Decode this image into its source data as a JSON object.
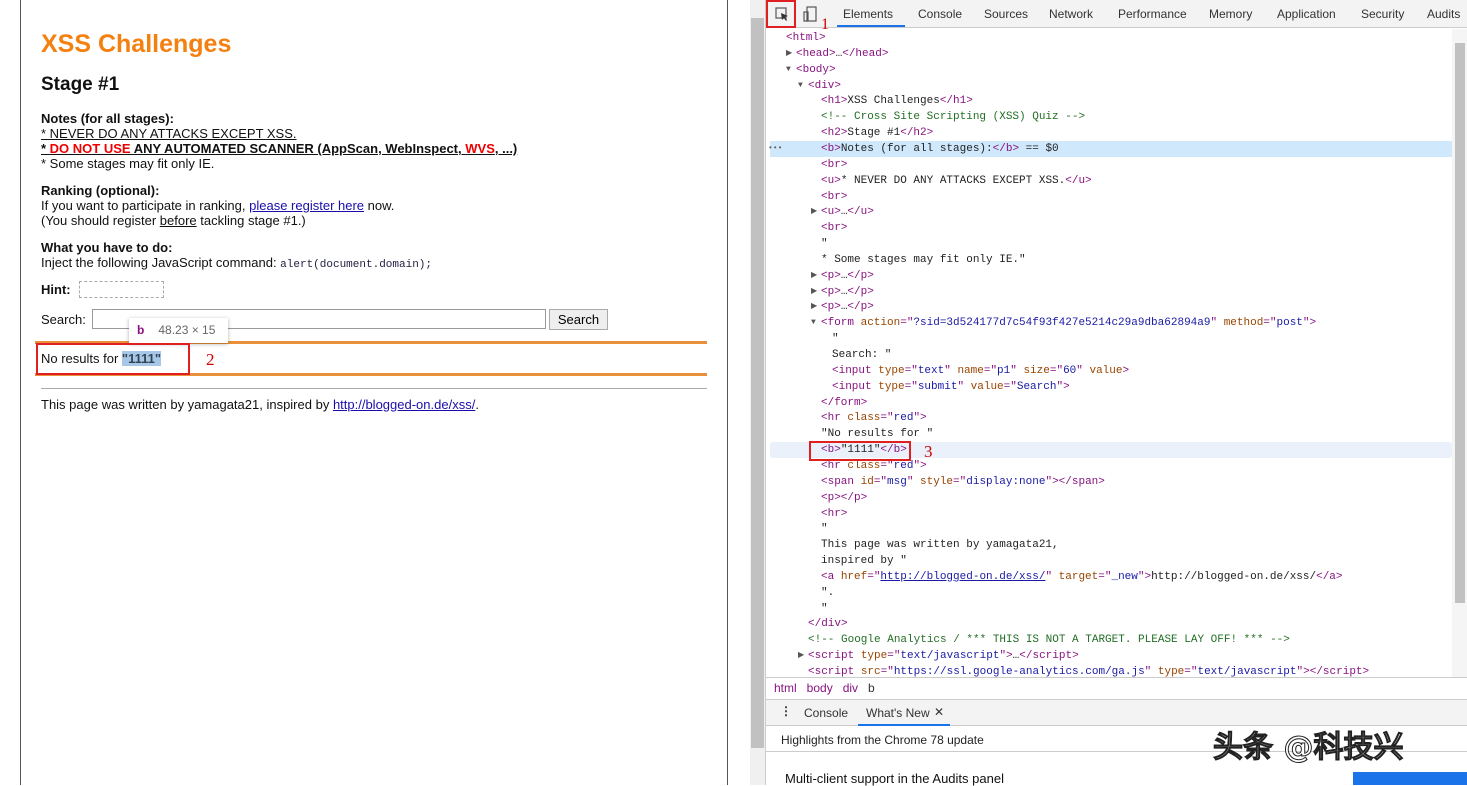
{
  "page": {
    "title": "XSS Challenges",
    "stage": "Stage #1",
    "notes_heading": "Notes (for all stages):",
    "note1": "* NEVER DO ANY ATTACKS EXCEPT XSS.",
    "note2_star": "* ",
    "note2_red": "DO NOT USE",
    "note2_mid": " ANY AUTOMATED SCANNER (AppScan, WebInspect, ",
    "note2_wvs": "WVS",
    "note2_end": ", ...)",
    "note3": "* Some stages may fit only IE.",
    "ranking_heading": "Ranking (optional):",
    "ranking_pre": "If you want to participate in ranking, ",
    "ranking_link": "please register here",
    "ranking_post": " now.",
    "register_pre": "(You should register ",
    "register_u": "before",
    "register_post": " tackling stage #1.)",
    "todo_heading": "What you have to do:",
    "todo_text": "Inject the following JavaScript command: ",
    "todo_code": "alert(document.domain);",
    "hint_label": "Hint:",
    "search_label": "Search:",
    "search_value": "",
    "search_button": "Search",
    "result_pre": "No results for ",
    "result_value": "\"1111\"",
    "footer_pre": "This page was written by yamagata21, inspired by ",
    "footer_link": "http://blogged-on.de/xss/",
    "footer_post": ".",
    "tooltip_tag": "b",
    "tooltip_dims": "48.23 × 15",
    "annotations": [
      "1",
      "2",
      "3"
    ]
  },
  "devtools": {
    "tabs": [
      "Elements",
      "Console",
      "Sources",
      "Network",
      "Performance",
      "Memory",
      "Application",
      "Security",
      "Audits"
    ],
    "active_tab": "Elements",
    "breadcrumbs": [
      "html",
      "body",
      "div",
      "b"
    ],
    "drawer_tabs": [
      "Console",
      "What's New"
    ],
    "highlights": "Highlights from the Chrome 78 update",
    "feature": "Multi-client support in the Audits panel",
    "watermark": "头条 @科技兴",
    "colors": {
      "tag": "#881280",
      "attr_name": "#994500",
      "attr_value": "#1a1aa6",
      "comment": "#236e25",
      "selection": "#cfe8fc"
    },
    "dom_lines": [
      {
        "x": 16,
        "t": [
          [
            "tg",
            "<html>"
          ]
        ]
      },
      {
        "x": 26,
        "a": "▶",
        "t": [
          [
            "tg",
            "<head>"
          ],
          [
            "tx",
            "…"
          ],
          [
            "tg",
            "</head>"
          ]
        ]
      },
      {
        "x": 26,
        "a": "▼",
        "t": [
          [
            "tg",
            "<body>"
          ]
        ]
      },
      {
        "x": 38,
        "a": "▼",
        "t": [
          [
            "tg",
            "<div>"
          ]
        ]
      },
      {
        "x": 51,
        "t": [
          [
            "tg",
            "<h1>"
          ],
          [
            "tx",
            "XSS Challenges"
          ],
          [
            "tg",
            "</h1>"
          ]
        ]
      },
      {
        "x": 51,
        "t": [
          [
            "cm",
            "<!-- Cross Site Scripting (XSS) Quiz -->"
          ]
        ]
      },
      {
        "x": 51,
        "t": [
          [
            "tg",
            "<h2>"
          ],
          [
            "tx",
            "Stage #1"
          ],
          [
            "tg",
            "</h2>"
          ]
        ]
      },
      {
        "x": 51,
        "sel": true,
        "t": [
          [
            "tg",
            "<b>"
          ],
          [
            "tx",
            "Notes (for all stages):"
          ],
          [
            "tg",
            "</b>"
          ],
          [
            "tx",
            " == $0"
          ]
        ]
      },
      {
        "x": 51,
        "t": [
          [
            "tg",
            "<br>"
          ]
        ]
      },
      {
        "x": 51,
        "t": [
          [
            "tg",
            "<u>"
          ],
          [
            "tx",
            "* NEVER DO ANY ATTACKS EXCEPT XSS."
          ],
          [
            "tg",
            "</u>"
          ]
        ]
      },
      {
        "x": 51,
        "t": [
          [
            "tg",
            "<br>"
          ]
        ]
      },
      {
        "x": 51,
        "a": "▶",
        "t": [
          [
            "tg",
            "<u>"
          ],
          [
            "tx",
            "…"
          ],
          [
            "tg",
            "</u>"
          ]
        ]
      },
      {
        "x": 51,
        "t": [
          [
            "tg",
            "<br>"
          ]
        ]
      },
      {
        "x": 51,
        "t": [
          [
            "tx",
            "\""
          ]
        ]
      },
      {
        "x": 51,
        "t": [
          [
            "tx",
            "* Some stages may fit only IE.\""
          ]
        ]
      },
      {
        "x": 51,
        "a": "▶",
        "t": [
          [
            "tg",
            "<p>"
          ],
          [
            "tx",
            "…"
          ],
          [
            "tg",
            "</p>"
          ]
        ]
      },
      {
        "x": 51,
        "a": "▶",
        "t": [
          [
            "tg",
            "<p>"
          ],
          [
            "tx",
            "…"
          ],
          [
            "tg",
            "</p>"
          ]
        ]
      },
      {
        "x": 51,
        "a": "▶",
        "t": [
          [
            "tg",
            "<p>"
          ],
          [
            "tx",
            "…"
          ],
          [
            "tg",
            "</p>"
          ]
        ]
      },
      {
        "x": 51,
        "a": "▼",
        "t": [
          [
            "tg",
            "<form "
          ],
          [
            "an",
            "action"
          ],
          [
            "tg",
            "=\""
          ],
          [
            "av",
            "?sid=3d524177d7c54f93f427e5214c29a9dba62894a9"
          ],
          [
            "tg",
            "\" "
          ],
          [
            "an",
            "method"
          ],
          [
            "tg",
            "=\""
          ],
          [
            "av",
            "post"
          ],
          [
            "tg",
            "\">"
          ]
        ]
      },
      {
        "x": 62,
        "t": [
          [
            "tx",
            "\""
          ]
        ]
      },
      {
        "x": 62,
        "t": [
          [
            "tx",
            "Search: \""
          ]
        ]
      },
      {
        "x": 62,
        "t": [
          [
            "tg",
            "<input "
          ],
          [
            "an",
            "type"
          ],
          [
            "tg",
            "=\""
          ],
          [
            "av",
            "text"
          ],
          [
            "tg",
            "\" "
          ],
          [
            "an",
            "name"
          ],
          [
            "tg",
            "=\""
          ],
          [
            "av",
            "p1"
          ],
          [
            "tg",
            "\" "
          ],
          [
            "an",
            "size"
          ],
          [
            "tg",
            "=\""
          ],
          [
            "av",
            "60"
          ],
          [
            "tg",
            "\" "
          ],
          [
            "an",
            "value"
          ],
          [
            "tg",
            ">"
          ]
        ]
      },
      {
        "x": 62,
        "t": [
          [
            "tg",
            "<input "
          ],
          [
            "an",
            "type"
          ],
          [
            "tg",
            "=\""
          ],
          [
            "av",
            "submit"
          ],
          [
            "tg",
            "\" "
          ],
          [
            "an",
            "value"
          ],
          [
            "tg",
            "=\""
          ],
          [
            "av",
            "Search"
          ],
          [
            "tg",
            "\">"
          ]
        ]
      },
      {
        "x": 51,
        "t": [
          [
            "tg",
            "</form>"
          ]
        ]
      },
      {
        "x": 51,
        "t": [
          [
            "tg",
            "<hr "
          ],
          [
            "an",
            "class"
          ],
          [
            "tg",
            "=\""
          ],
          [
            "av",
            "red"
          ],
          [
            "tg",
            "\">"
          ]
        ]
      },
      {
        "x": 51,
        "t": [
          [
            "tx",
            "\"No results for \""
          ]
        ]
      },
      {
        "x": 51,
        "hov": true,
        "t": [
          [
            "tg",
            "<b>"
          ],
          [
            "tx",
            "\"1111\""
          ],
          [
            "tg",
            "</b>"
          ]
        ]
      },
      {
        "x": 51,
        "t": [
          [
            "tg",
            "<hr "
          ],
          [
            "an",
            "class"
          ],
          [
            "tg",
            "=\""
          ],
          [
            "av",
            "red"
          ],
          [
            "tg",
            "\">"
          ]
        ]
      },
      {
        "x": 51,
        "t": [
          [
            "tg",
            "<span "
          ],
          [
            "an",
            "id"
          ],
          [
            "tg",
            "=\""
          ],
          [
            "av",
            "msg"
          ],
          [
            "tg",
            "\" "
          ],
          [
            "an",
            "style"
          ],
          [
            "tg",
            "=\""
          ],
          [
            "av",
            "display:none"
          ],
          [
            "tg",
            "\"></span>"
          ]
        ]
      },
      {
        "x": 51,
        "t": [
          [
            "tg",
            "<p></p>"
          ]
        ]
      },
      {
        "x": 51,
        "t": [
          [
            "tg",
            "<hr>"
          ]
        ]
      },
      {
        "x": 51,
        "t": [
          [
            "tx",
            "\""
          ]
        ]
      },
      {
        "x": 51,
        "t": [
          [
            "tx",
            "This page was written by yamagata21,"
          ]
        ]
      },
      {
        "x": 51,
        "t": [
          [
            "tx",
            "inspired by \""
          ]
        ]
      },
      {
        "x": 51,
        "t": [
          [
            "tg",
            "<a "
          ],
          [
            "an",
            "href"
          ],
          [
            "tg",
            "=\""
          ],
          [
            "lk",
            "http://blogged-on.de/xss/"
          ],
          [
            "tg",
            "\" "
          ],
          [
            "an",
            "target"
          ],
          [
            "tg",
            "=\""
          ],
          [
            "av",
            "_new"
          ],
          [
            "tg",
            "\">"
          ],
          [
            "tx",
            "http://blogged-on.de/xss/"
          ],
          [
            "tg",
            "</a>"
          ]
        ]
      },
      {
        "x": 51,
        "t": [
          [
            "tx",
            "\"."
          ]
        ]
      },
      {
        "x": 51,
        "t": [
          [
            "tx",
            "\""
          ]
        ]
      },
      {
        "x": 38,
        "t": [
          [
            "tg",
            "</div>"
          ]
        ]
      },
      {
        "x": 38,
        "t": [
          [
            "cm",
            "<!-- Google Analytics / *** THIS IS NOT A TARGET. PLEASE LAY OFF! *** -->"
          ]
        ]
      },
      {
        "x": 38,
        "a": "▶",
        "t": [
          [
            "tg",
            "<script "
          ],
          [
            "an",
            "type"
          ],
          [
            "tg",
            "=\""
          ],
          [
            "av",
            "text/javascript"
          ],
          [
            "tg",
            "\">"
          ],
          [
            "tx",
            "…"
          ],
          [
            "tg",
            "</script>"
          ]
        ]
      },
      {
        "x": 38,
        "t": [
          [
            "tg",
            "<script "
          ],
          [
            "an",
            "src"
          ],
          [
            "tg",
            "=\""
          ],
          [
            "av",
            "https://ssl.google-analytics.com/ga.js"
          ],
          [
            "tg",
            "\" "
          ],
          [
            "an",
            "type"
          ],
          [
            "tg",
            "=\""
          ],
          [
            "av",
            "text/javascript"
          ],
          [
            "tg",
            "\"></script>"
          ]
        ]
      }
    ]
  }
}
